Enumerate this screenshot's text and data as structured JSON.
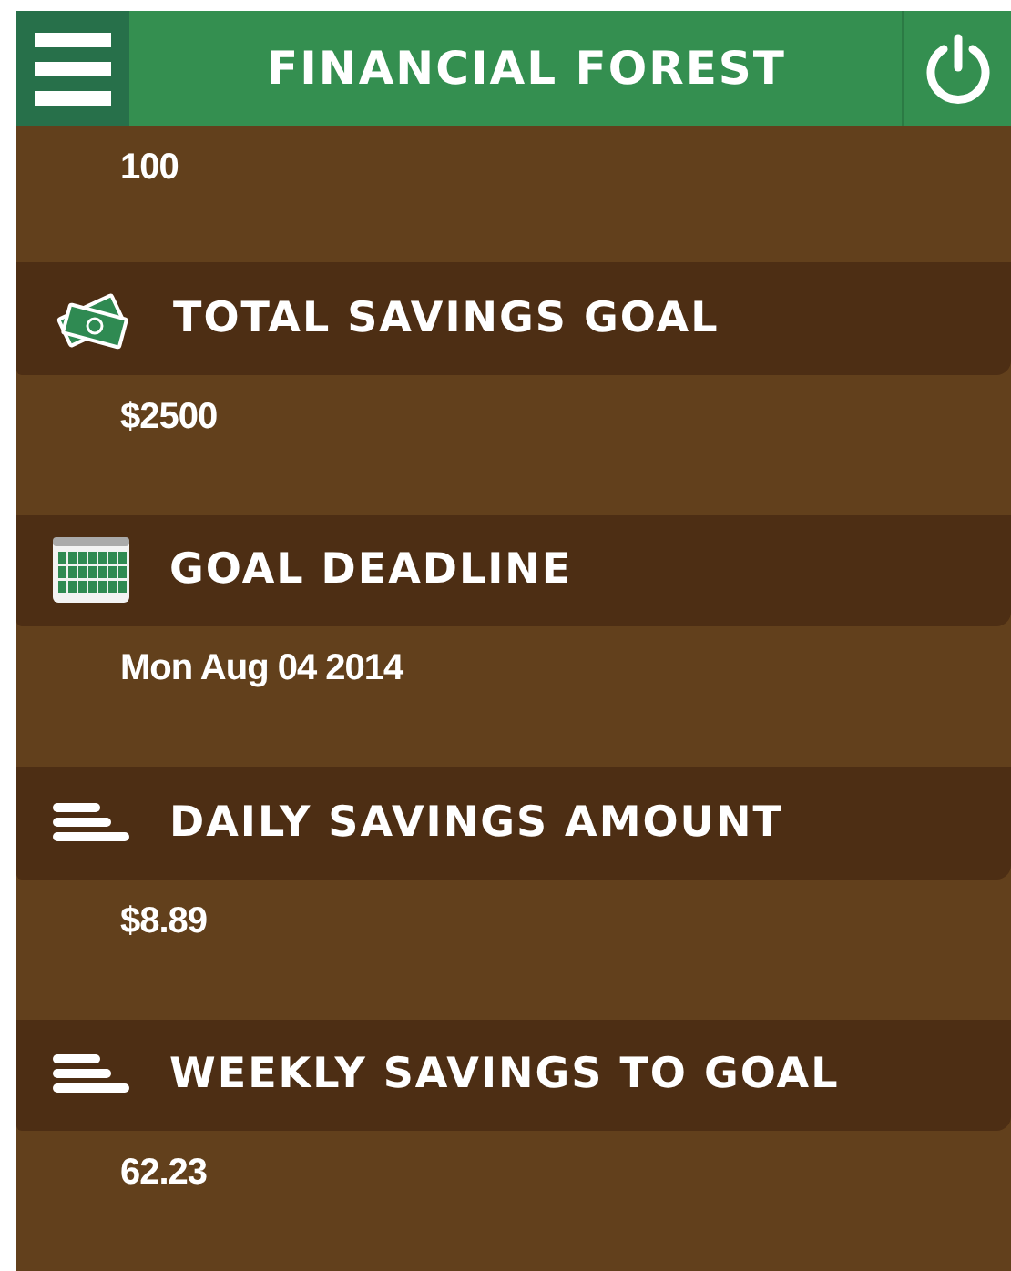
{
  "header": {
    "title": "FINANCIAL FOREST"
  },
  "top_value": "100",
  "sections": [
    {
      "kind": "money",
      "label": "TOTAL SAVINGS GOAL",
      "value": "$2500"
    },
    {
      "kind": "calendar",
      "label": "GOAL DEADLINE",
      "value": "Mon Aug 04 2014"
    },
    {
      "kind": "lines",
      "label": "DAILY SAVINGS AMOUNT",
      "value": "$8.89"
    },
    {
      "kind": "lines",
      "label": "WEEKLY SAVINGS TO GOAL",
      "value": "62.23"
    }
  ]
}
